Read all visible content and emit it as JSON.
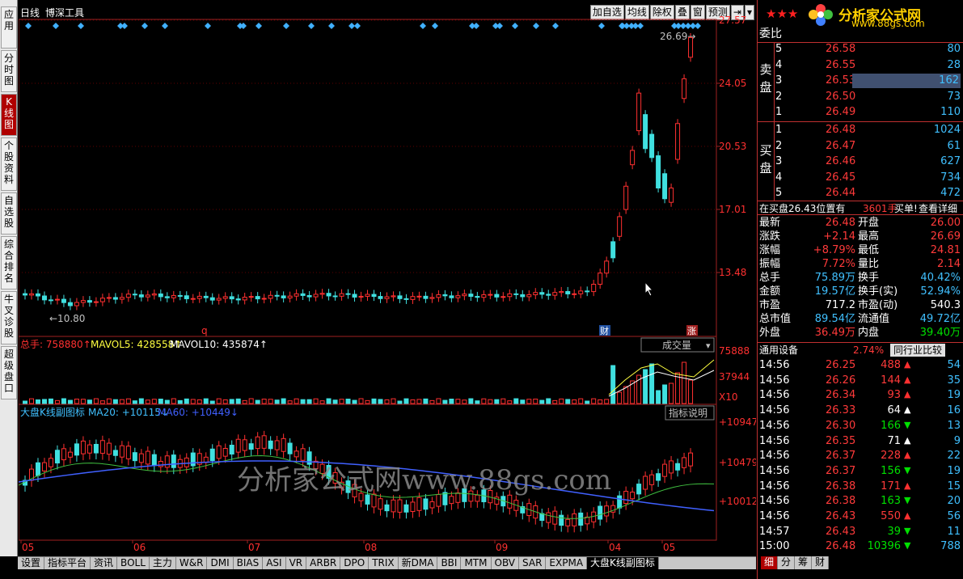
{
  "left_tabs": [
    "应用",
    "分时图",
    "K线图",
    "个股资料",
    "自选股",
    "综合排名",
    "牛叉诊股",
    "超级盘口"
  ],
  "chart": {
    "period_label": "日线",
    "tool_label": "博深工具",
    "toolbar": [
      "加自选",
      "均线",
      "除权",
      "叠",
      "窗",
      "预测",
      "⇥",
      "▾"
    ],
    "price_axis": [
      "27.57",
      "24.05",
      "20.53",
      "17.01",
      "13.48"
    ],
    "high_label": "26.69",
    "low_label": "10.80",
    "markers": {
      "q": "q",
      "cai": "财",
      "zhang": "涨"
    },
    "volume": {
      "total_label": "总手: 758880",
      "mavol5_label": "MAVOL5: 428558",
      "mavol10_label": "MAVOL10: 435874",
      "type_button": "成交量",
      "axis": [
        "75888",
        "37944",
        "X10"
      ]
    },
    "index": {
      "title": "大盘K线副图标",
      "ma20_label": "MA20: +10115",
      "ma60_label": "MA60: +10449",
      "help_button": "指标说明",
      "axis": [
        "+10947",
        "+10479",
        "+10012"
      ]
    },
    "watermark": "分析家公式网www.88gs.com",
    "months": [
      "05",
      "06",
      "07",
      "08",
      "09",
      "04",
      "05"
    ],
    "bottom_tabs": [
      "设置",
      "指标平台",
      "资讯",
      "BOLL",
      "主力",
      "W&R",
      "DMI",
      "BIAS",
      "ASI",
      "VR",
      "ARBR",
      "DPO",
      "TRIX",
      "新DMA",
      "BBI",
      "MTM",
      "OBV",
      "SAR",
      "EXPMA",
      "大盘K线副图标"
    ]
  },
  "panel": {
    "logo_text": "分析家公式网",
    "logo_url": "www.88gs.com",
    "stars": "★★★",
    "weibi_label": "委比",
    "sell_label": "卖盘",
    "buy_label": "买盘",
    "sell": [
      {
        "n": "5",
        "p": "26.58",
        "v": "80"
      },
      {
        "n": "4",
        "p": "26.55",
        "v": "28"
      },
      {
        "n": "3",
        "p": "26.53",
        "v": "162"
      },
      {
        "n": "2",
        "p": "26.50",
        "v": "73"
      },
      {
        "n": "1",
        "p": "26.49",
        "v": "110"
      }
    ],
    "buy": [
      {
        "n": "1",
        "p": "26.48",
        "v": "1024"
      },
      {
        "n": "2",
        "p": "26.47",
        "v": "61"
      },
      {
        "n": "3",
        "p": "26.46",
        "v": "627"
      },
      {
        "n": "4",
        "p": "26.45",
        "v": "734"
      },
      {
        "n": "5",
        "p": "26.44",
        "v": "472"
      }
    ],
    "bar_info": {
      "pos": "在买盘26.43位置有",
      "qty": "3601手",
      "buy": "买单!",
      "detail": "查看详细"
    },
    "stats": [
      {
        "l1": "最新",
        "v1": "26.48",
        "l2": "开盘",
        "v2": "26.00"
      },
      {
        "l1": "涨跌",
        "v1": "+2.14",
        "l2": "最高",
        "v2": "26.69"
      },
      {
        "l1": "涨幅",
        "v1": "+8.79%",
        "l2": "最低",
        "v2": "24.81"
      },
      {
        "l1": "振幅",
        "v1": "7.72%",
        "l2": "量比",
        "v2": "2.14"
      },
      {
        "l1": "总手",
        "v1": "75.89万",
        "l2": "换手",
        "v2": "40.42%"
      },
      {
        "l1": "金额",
        "v1": "19.57亿",
        "l2": "换手(实)",
        "v2": "52.94%"
      },
      {
        "l1": "市盈",
        "v1": "717.2",
        "l2": "市盈(动)",
        "v2": "540.3"
      },
      {
        "l1": "总市值",
        "v1": "89.54亿",
        "l2": "流通值",
        "v2": "49.72亿"
      },
      {
        "l1": "外盘",
        "v1": "36.49万",
        "l2": "内盘",
        "v2": "39.40万"
      }
    ],
    "sector": {
      "name": "通用设备",
      "pct": "2.74%",
      "compare": "同行业比较"
    },
    "ticks": [
      {
        "t": "14:56",
        "p": "26.25",
        "v": "488",
        "d": "up",
        "n": "54"
      },
      {
        "t": "14:56",
        "p": "26.26",
        "v": "144",
        "d": "up",
        "n": "35"
      },
      {
        "t": "14:56",
        "p": "26.34",
        "v": "93",
        "d": "up",
        "n": "19"
      },
      {
        "t": "14:56",
        "p": "26.33",
        "v": "64",
        "d": "wup",
        "n": "16"
      },
      {
        "t": "14:56",
        "p": "26.30",
        "v": "166",
        "d": "down",
        "n": "13"
      },
      {
        "t": "14:56",
        "p": "26.35",
        "v": "71",
        "d": "wup",
        "n": "9"
      },
      {
        "t": "14:56",
        "p": "26.37",
        "v": "228",
        "d": "up",
        "n": "22"
      },
      {
        "t": "14:56",
        "p": "26.37",
        "v": "156",
        "d": "down",
        "n": "19"
      },
      {
        "t": "14:56",
        "p": "26.38",
        "v": "171",
        "d": "up",
        "n": "15"
      },
      {
        "t": "14:56",
        "p": "26.38",
        "v": "163",
        "d": "down",
        "n": "20"
      },
      {
        "t": "14:56",
        "p": "26.43",
        "v": "550",
        "d": "up",
        "n": "56"
      },
      {
        "t": "14:57",
        "p": "26.43",
        "v": "39",
        "d": "down",
        "n": "11"
      },
      {
        "t": "15:00",
        "p": "26.48",
        "v": "10396",
        "d": "down",
        "n": "788"
      }
    ],
    "bottom_tabs": [
      "细",
      "分",
      "筹",
      "财"
    ]
  },
  "colors": {
    "up": "#ff3030",
    "down": "#40e0e0",
    "bg": "#000000"
  }
}
